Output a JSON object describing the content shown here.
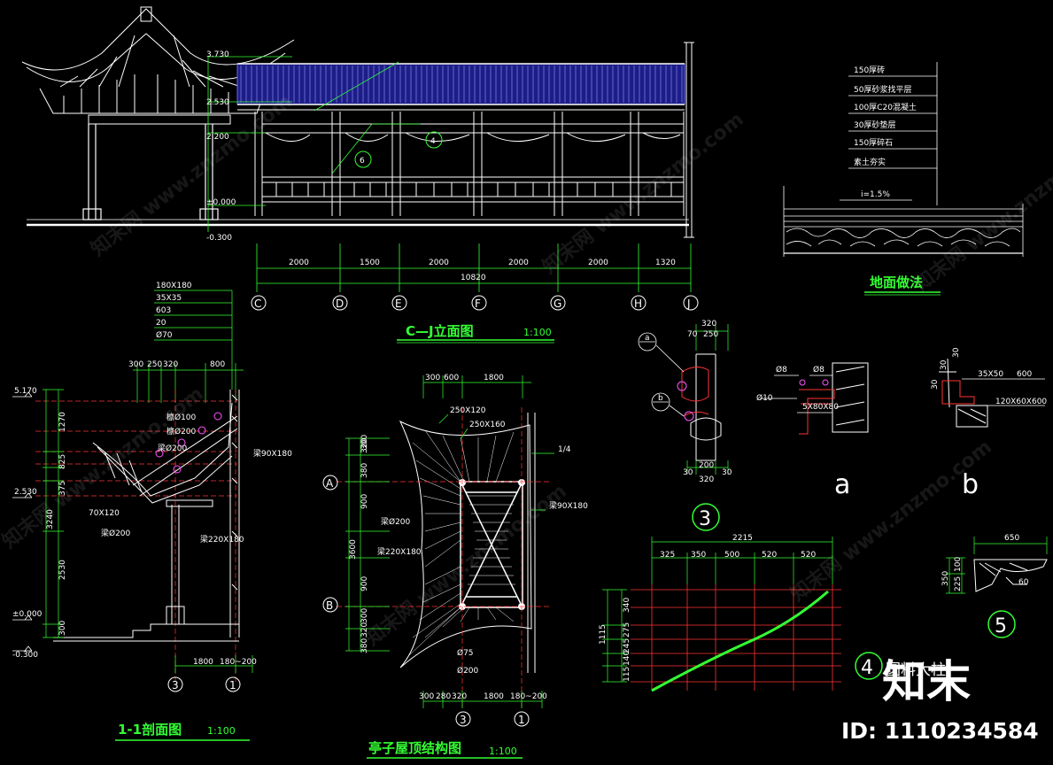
{
  "titles": {
    "elevation": "C—J立面图",
    "elevation_scale": "1:100",
    "section": "1-1剖面图",
    "section_scale": "1:100",
    "roof": "亭子屋顶结构图",
    "roof_scale": "1:100",
    "floor": "地面做法",
    "column": "圆料大柱"
  },
  "elevation": {
    "levels": [
      "3.730",
      "2.530",
      "2.200",
      "±0.000",
      "-0.300"
    ],
    "spans": [
      "2000",
      "1500",
      "2000",
      "2000",
      "2000",
      "1320"
    ],
    "total": "10820",
    "axes": [
      "C",
      "D",
      "E",
      "F",
      "G",
      "H",
      "J"
    ],
    "callouts": [
      "4",
      "6"
    ]
  },
  "floor": {
    "layers": [
      "150厚砖",
      "50厚砂浆找平层",
      "100厚C20混凝土",
      "30厚砂垫层",
      "150厚碎石",
      "素土夯实"
    ],
    "slope": "i=1.5%"
  },
  "section": {
    "notes": [
      "180X180",
      "35X35",
      "603",
      "20",
      "Ø70"
    ],
    "top_dims": [
      "300",
      "250",
      "320",
      "800"
    ],
    "levels": [
      "5.170",
      "2.530",
      "±0.000",
      "-0.300"
    ],
    "vert_dims": [
      "1270",
      "825",
      "375",
      "3240",
      "2530",
      "300"
    ],
    "labels": [
      "檩Ø100",
      "檩Ø200",
      "梁Ø200",
      "70X120",
      "梁Ø200",
      "梁220X180",
      "梁90X180"
    ],
    "bottom_dims": [
      "1800",
      "180~200"
    ],
    "axes": [
      "3",
      "1"
    ]
  },
  "roof": {
    "top_dims": [
      "300",
      "600",
      "1800"
    ],
    "labels": [
      "250X120",
      "250X160",
      "梁Ø200",
      "梁220X180",
      "Ø75",
      "Ø200",
      "1/4",
      "梁90X180"
    ],
    "side_dims": [
      "320",
      "380",
      "300",
      "900",
      "3600",
      "900",
      "300",
      "320",
      "380"
    ],
    "bottom_dims": [
      "300",
      "280",
      "320",
      "1800",
      "180~200"
    ],
    "axes_left": [
      "A",
      "B"
    ],
    "axes_bottom": [
      "3",
      "1"
    ]
  },
  "detail3": {
    "dims_top": [
      "320",
      "70",
      "250"
    ],
    "dims_bottom": [
      "30",
      "200",
      "30",
      "320"
    ],
    "markers": [
      "a",
      "b"
    ],
    "number": "3"
  },
  "detail_a": {
    "labels": [
      "Ø8",
      "Ø8",
      "Ø10",
      "5X80X80"
    ],
    "marker": "a"
  },
  "detail_b": {
    "labels": [
      "35X50",
      "600",
      "120X60X600",
      "30",
      "30",
      "30"
    ],
    "marker": "b"
  },
  "curve": {
    "total": "2215",
    "spans": [
      "325",
      "350",
      "500",
      "520",
      "520"
    ],
    "height": "1115",
    "heights": [
      "340",
      "275",
      "245",
      "140",
      "115"
    ],
    "number": "4"
  },
  "detail5": {
    "dims": [
      "650",
      "350",
      "225",
      "100",
      "60"
    ],
    "number": "5"
  },
  "watermark": {
    "brand": "知末",
    "id": "ID: 1110234584",
    "text": "知末网 www.znzmo.com"
  }
}
